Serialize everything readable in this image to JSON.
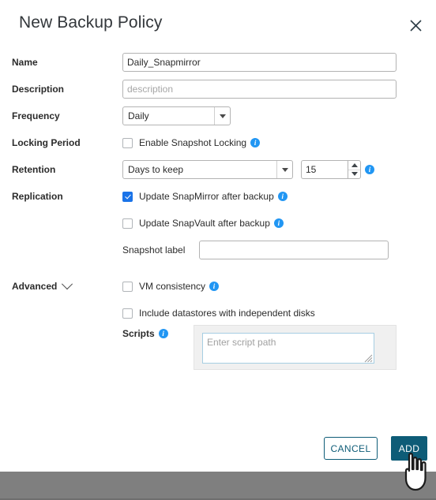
{
  "dialog": {
    "title": "New Backup Policy",
    "close_icon": "close-icon"
  },
  "fields": {
    "name": {
      "label": "Name",
      "value": "Daily_Snapmirror",
      "placeholder": ""
    },
    "description": {
      "label": "Description",
      "value": "",
      "placeholder": "description"
    },
    "frequency": {
      "label": "Frequency",
      "selected": "Daily"
    },
    "locking_period": {
      "label": "Locking Period",
      "checkbox_label": "Enable Snapshot Locking",
      "checked": false,
      "info_icon": "info-icon"
    },
    "retention": {
      "label": "Retention",
      "selected": "Days to keep",
      "count": "15",
      "info_icon": "info-icon"
    },
    "replication": {
      "label": "Replication",
      "snapmirror": {
        "label": "Update SnapMirror after backup",
        "checked": true
      },
      "snapvault": {
        "label": "Update SnapVault after backup",
        "checked": false
      },
      "snapshot_label": {
        "label": "Snapshot label",
        "value": "",
        "placeholder": ""
      }
    },
    "advanced": {
      "label": "Advanced",
      "chevron_icon": "chevron-down-icon",
      "vm_consistency": {
        "label": "VM consistency",
        "checked": false
      },
      "independent_disks": {
        "label": "Include datastores with independent disks",
        "checked": false
      },
      "scripts": {
        "label": "Scripts",
        "value": "",
        "placeholder": "Enter script path",
        "info_icon": "info-icon"
      }
    }
  },
  "footer": {
    "cancel_label": "CANCEL",
    "add_label": "ADD"
  },
  "colors": {
    "accent": "#0e5c77",
    "checkbox_checked": "#1a73e8",
    "info_blue": "#2196f3",
    "bottom_bar": "#7f7f7f"
  }
}
